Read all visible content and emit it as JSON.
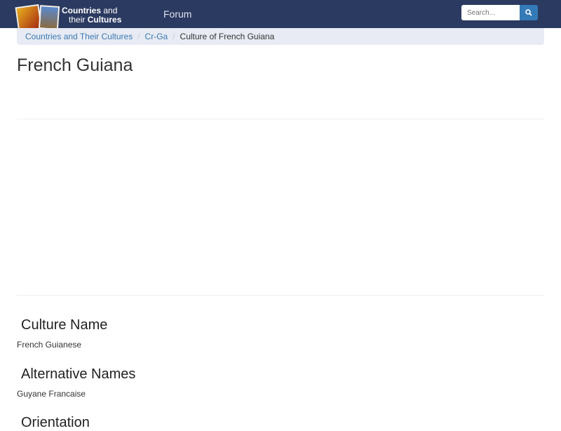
{
  "header": {
    "logo_line1_bold": "Countries",
    "logo_line1": " and",
    "logo_line2": "their ",
    "logo_line2_bold": "Cultures",
    "nav_forum": "Forum",
    "search_placeholder": "Search...",
    "search_icon": "search-icon"
  },
  "breadcrumb": [
    "Countries and Their Cultures",
    "Cr-Ga",
    "Culture of French Guiana"
  ],
  "title": "French Guiana",
  "sections": [
    {
      "heading": "Culture Name",
      "text": "French Guianese"
    },
    {
      "heading": "Alternative Names",
      "text": "Guyane Francaise"
    },
    {
      "heading": "Orientation"
    }
  ],
  "colors": {
    "navbar": "#2b3a60",
    "link": "#3a78b5",
    "button": "#337ab7"
  }
}
